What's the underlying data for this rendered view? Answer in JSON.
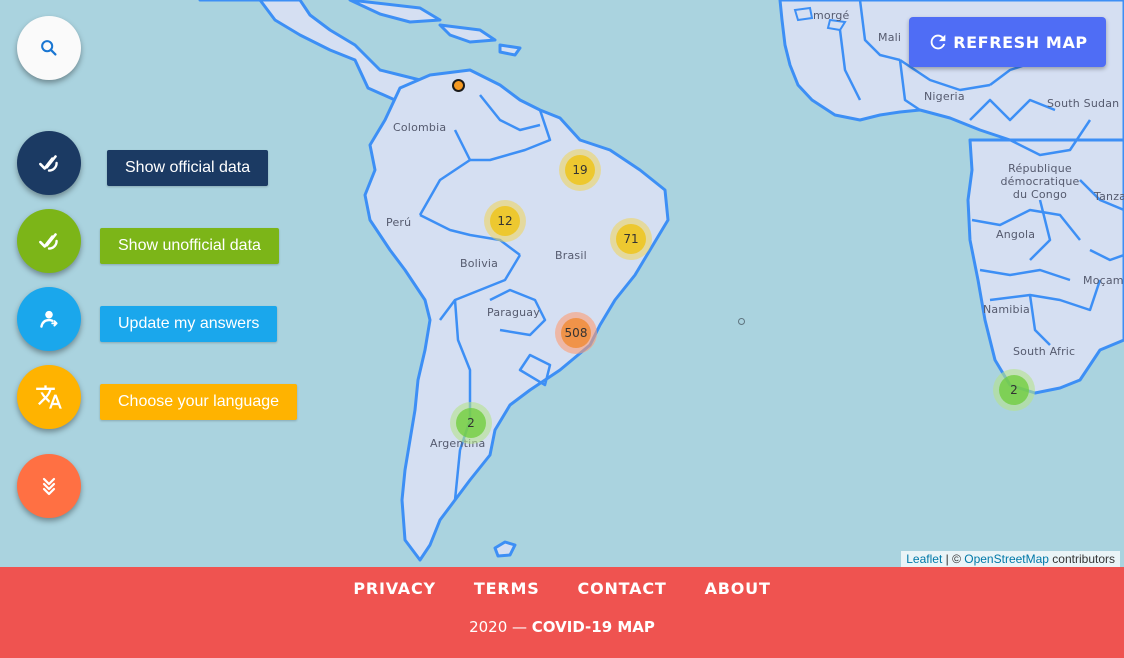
{
  "map": {
    "land_color": "#d5dff2",
    "border_color": "#3d8ff5",
    "water_color": "#aad3df",
    "place_labels": [
      {
        "id": "morge",
        "text": "morgé"
      },
      {
        "id": "mali",
        "text": "Mali"
      },
      {
        "id": "nigeria",
        "text": "Nigeria"
      },
      {
        "id": "south-sudan",
        "text": "South Sudan"
      },
      {
        "id": "colombia",
        "text": "Colombia"
      },
      {
        "id": "peru",
        "text": "Perú"
      },
      {
        "id": "bolivia",
        "text": "Bolivia"
      },
      {
        "id": "brasil",
        "text": "Brasil"
      },
      {
        "id": "paraguay",
        "text": "Paraguay"
      },
      {
        "id": "argentina",
        "text": "Argentina"
      },
      {
        "id": "drc",
        "text": "République démocratique du Congo"
      },
      {
        "id": "tanzania",
        "text": "Tanza"
      },
      {
        "id": "angola",
        "text": "Angola"
      },
      {
        "id": "namibia",
        "text": "Namibia"
      },
      {
        "id": "mocambique",
        "text": "Moçam"
      },
      {
        "id": "south-africa",
        "text": "South Afric"
      }
    ],
    "clusters": [
      {
        "id": "brazil-ne",
        "count": "19",
        "level": "yellow"
      },
      {
        "id": "brazil-w",
        "count": "12",
        "level": "yellow"
      },
      {
        "id": "brazil-e",
        "count": "71",
        "level": "yellow"
      },
      {
        "id": "brazil-se",
        "count": "508",
        "level": "orange"
      },
      {
        "id": "argentina",
        "count": "2",
        "level": "green"
      },
      {
        "id": "south-africa",
        "count": "2",
        "level": "green"
      }
    ],
    "attribution": {
      "leaflet": "Leaflet",
      "sep": " | © ",
      "osm": "OpenStreetMap",
      "suffix": " contributors"
    }
  },
  "refresh": {
    "label": "REFRESH MAP",
    "icon": "refresh-icon",
    "color": "#4f6df5"
  },
  "search": {
    "icon": "search-icon"
  },
  "actions": [
    {
      "id": "official",
      "label": "Show official data",
      "icon": "check-icon",
      "color": "#1b3a63"
    },
    {
      "id": "unofficial",
      "label": "Show unofficial data",
      "icon": "check-icon",
      "color": "#7cb518"
    },
    {
      "id": "update",
      "label": "Update my answers",
      "icon": "user-update-icon",
      "color": "#1aa7ec"
    },
    {
      "id": "language",
      "label": "Choose your language",
      "icon": "translate-icon",
      "color": "#ffb300"
    }
  ],
  "toggle": {
    "icon": "double-chevron-down-icon",
    "color": "#ff7043"
  },
  "footer": {
    "links": [
      "PRIVACY",
      "TERMS",
      "CONTACT",
      "ABOUT"
    ],
    "year": "2020 — ",
    "brand": "COVID-19 MAP",
    "color": "#ef5350"
  }
}
